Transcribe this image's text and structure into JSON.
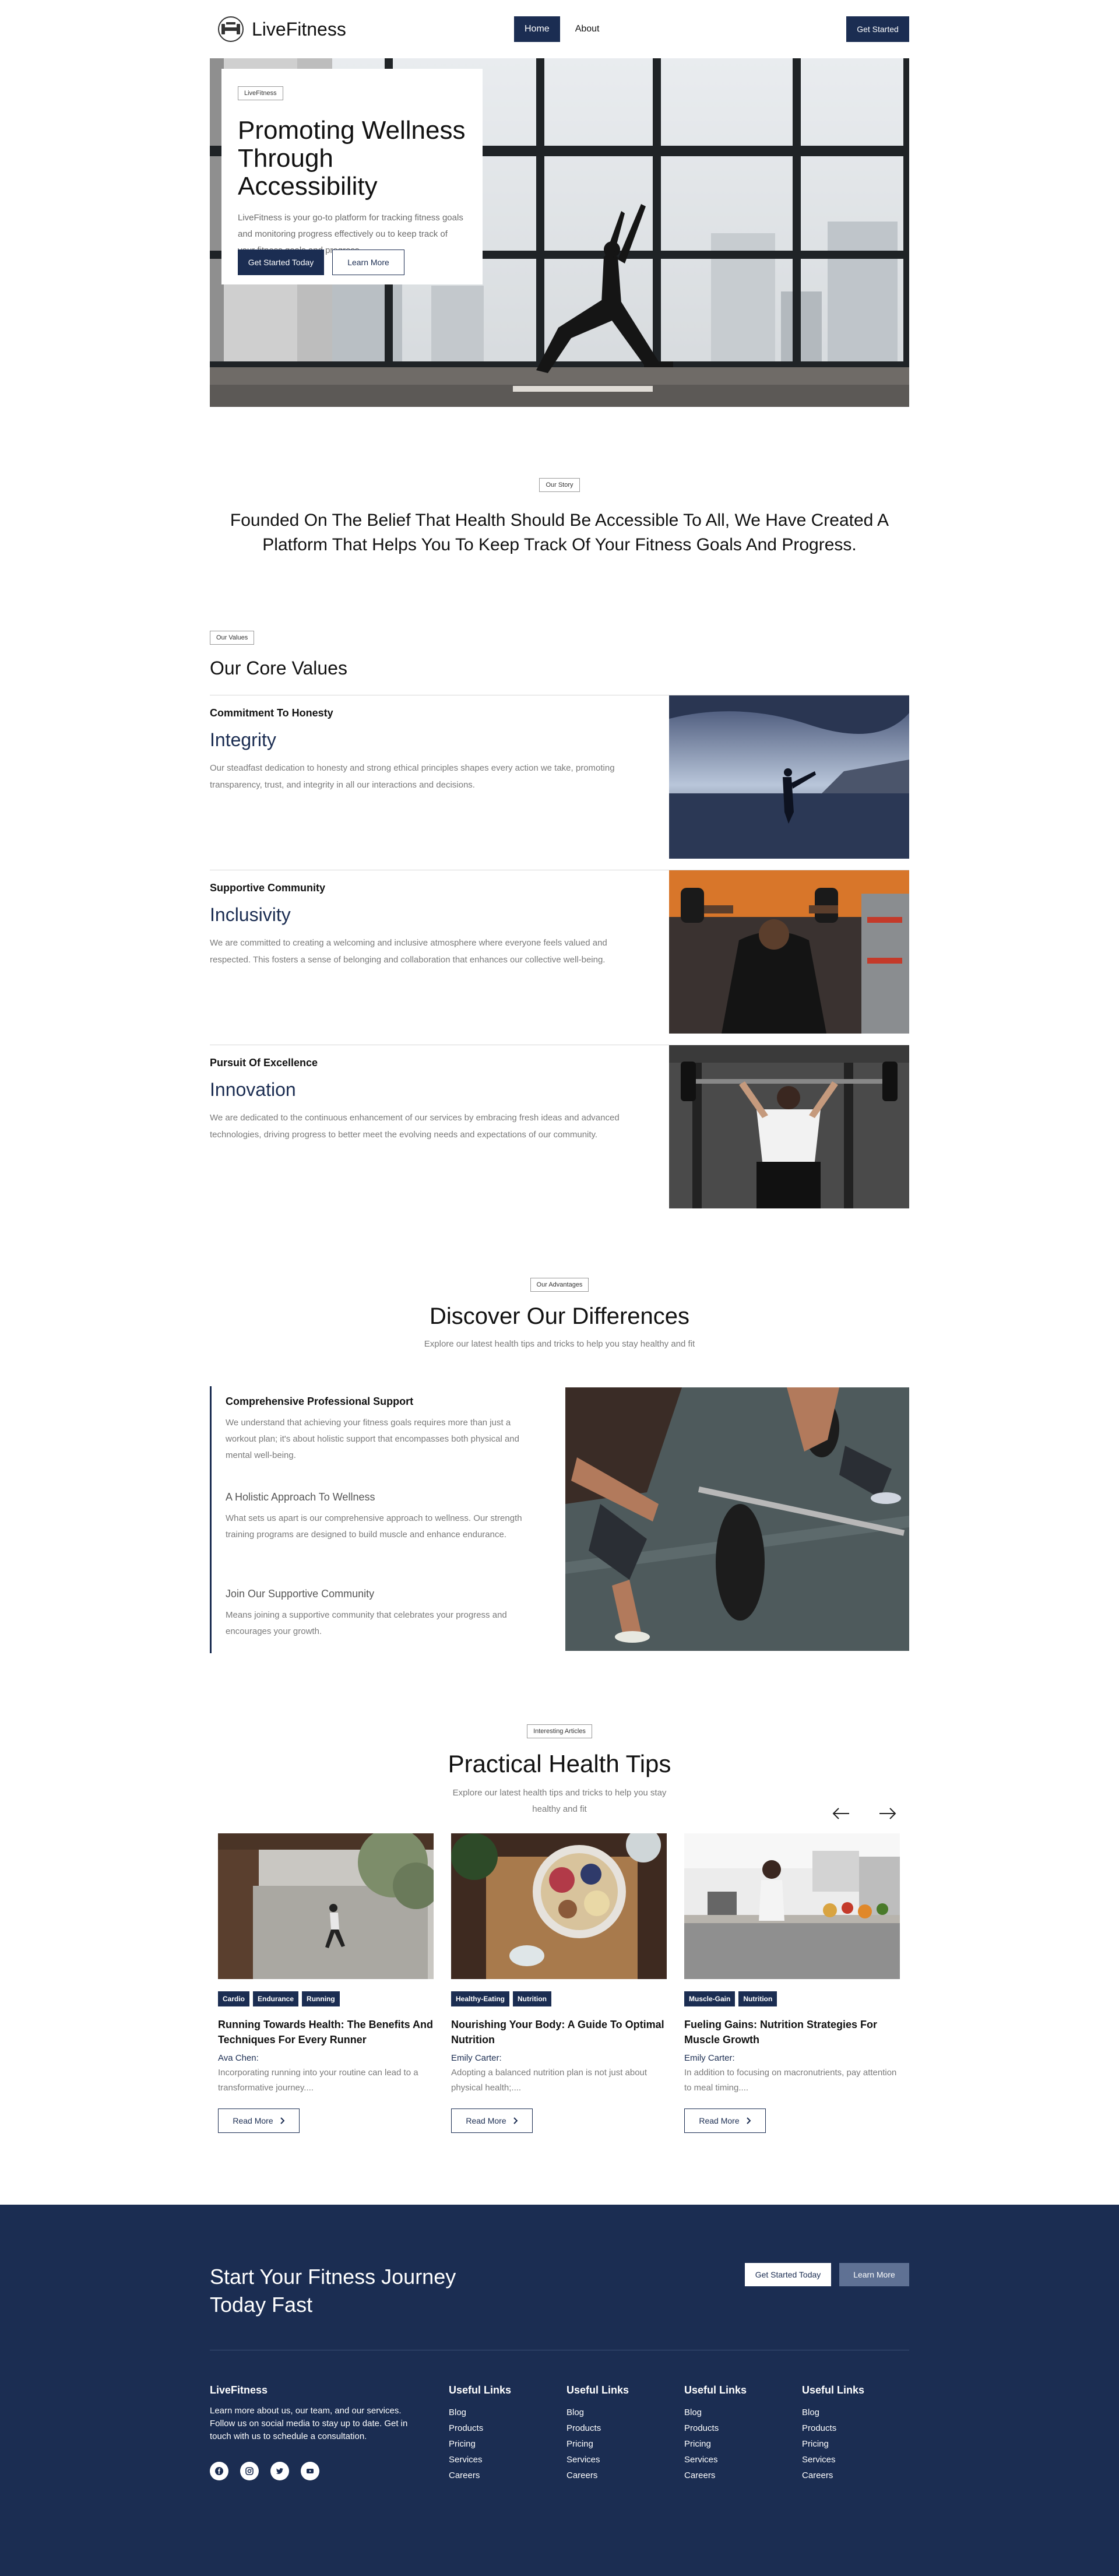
{
  "header": {
    "brand": "LiveFitness",
    "nav": [
      {
        "label": "Home"
      },
      {
        "label": "About"
      }
    ],
    "cta": "Get Started"
  },
  "hero": {
    "tag": "LiveFitness",
    "title": "Promoting Wellness Through Accessibility",
    "description": "LiveFitness is your go-to platform for tracking fitness goals and monitoring progress effectively ou to keep track of your fitness goals and progress.",
    "primary_btn": "Get Started Today",
    "secondary_btn": "Learn More"
  },
  "story": {
    "tag": "Our Story",
    "text": "Founded On The Belief That Health Should Be Accessible To All, We Have Created A Platform That Helps You To Keep Track Of Your Fitness Goals And Progress."
  },
  "values": {
    "tag": "Our Values",
    "title": "Our Core Values",
    "items": [
      {
        "subtitle": "Commitment To Honesty",
        "title": "Integrity",
        "description": "Our steadfast dedication to honesty and strong ethical principles shapes every action we take, promoting transparency, trust, and integrity in all our interactions and decisions."
      },
      {
        "subtitle": "Supportive Community",
        "title": "Inclusivity",
        "description": "We are committed to creating a welcoming and inclusive atmosphere where everyone feels valued and respected. This fosters a sense of belonging and collaboration that enhances our collective well-being."
      },
      {
        "subtitle": "Pursuit Of Excellence",
        "title": "Innovation",
        "description": "We are dedicated to the continuous enhancement of our services by embracing fresh ideas and advanced technologies, driving progress to better meet the evolving needs and expectations of our community."
      }
    ]
  },
  "advantages": {
    "tag": "Our Advantages",
    "title": "Discover Our Differences",
    "subtitle": "Explore our latest health tips and tricks to help you stay healthy and fit",
    "items": [
      {
        "title": "Comprehensive Professional Support",
        "description": "We understand that achieving your fitness goals requires more than just a workout plan; it's about holistic support that encompasses both physical and mental well-being."
      },
      {
        "title": "A Holistic Approach To Wellness",
        "description": "What sets us apart is our comprehensive approach to wellness. Our strength training programs are designed to build muscle and enhance endurance."
      },
      {
        "title": "Join Our Supportive Community",
        "description": "Means joining a supportive community that celebrates your progress and encourages your growth."
      }
    ]
  },
  "articles": {
    "tag": "Interesting Articles",
    "title": "Practical Health Tips",
    "subtitle": "Explore our latest health tips and tricks to help you stay healthy and fit",
    "read_more": "Read More",
    "items": [
      {
        "tags": [
          "Cardio",
          "Endurance",
          "Running"
        ],
        "title": "Running Towards Health: The Benefits And Techniques For Every Runner",
        "author": "Ava Chen:",
        "excerpt": "Incorporating running into your routine can lead to a transformative journey...."
      },
      {
        "tags": [
          "Healthy-Eating",
          "Nutrition"
        ],
        "title": "Nourishing Your Body: A Guide To Optimal Nutrition",
        "author": "Emily Carter:",
        "excerpt": "Adopting a balanced nutrition plan is not just about physical health;...."
      },
      {
        "tags": [
          "Muscle-Gain",
          "Nutrition"
        ],
        "title": "Fueling Gains: Nutrition Strategies For Muscle Growth",
        "author": "Emily Carter:",
        "excerpt": "In addition to focusing on macronutrients, pay attention to meal timing...."
      }
    ]
  },
  "footer": {
    "cta_title": "Start Your Fitness Journey Today Fast",
    "cta_primary": "Get Started Today",
    "cta_secondary": "Learn More",
    "about_title": "LiveFitness",
    "about_text": "Learn more about us, our team, and our services. Follow us on social media to stay up to date. Get in touch with us to schedule a consultation.",
    "columns": [
      {
        "title": "Useful Links",
        "links": [
          "Blog",
          "Products",
          "Pricing",
          "Services",
          "Careers"
        ]
      },
      {
        "title": "Useful Links",
        "links": [
          "Blog",
          "Products",
          "Pricing",
          "Services",
          "Careers"
        ]
      },
      {
        "title": "Useful Links",
        "links": [
          "Blog",
          "Products",
          "Pricing",
          "Services",
          "Careers"
        ]
      },
      {
        "title": "Useful Links",
        "links": [
          "Blog",
          "Products",
          "Pricing",
          "Services",
          "Careers"
        ]
      }
    ],
    "socials": [
      "facebook-icon",
      "instagram-icon",
      "twitter-icon",
      "youtube-icon"
    ]
  },
  "colors": {
    "primary": "#1b2d52",
    "muted_text": "#7a7a7a",
    "footer_button": "#5f7194"
  }
}
